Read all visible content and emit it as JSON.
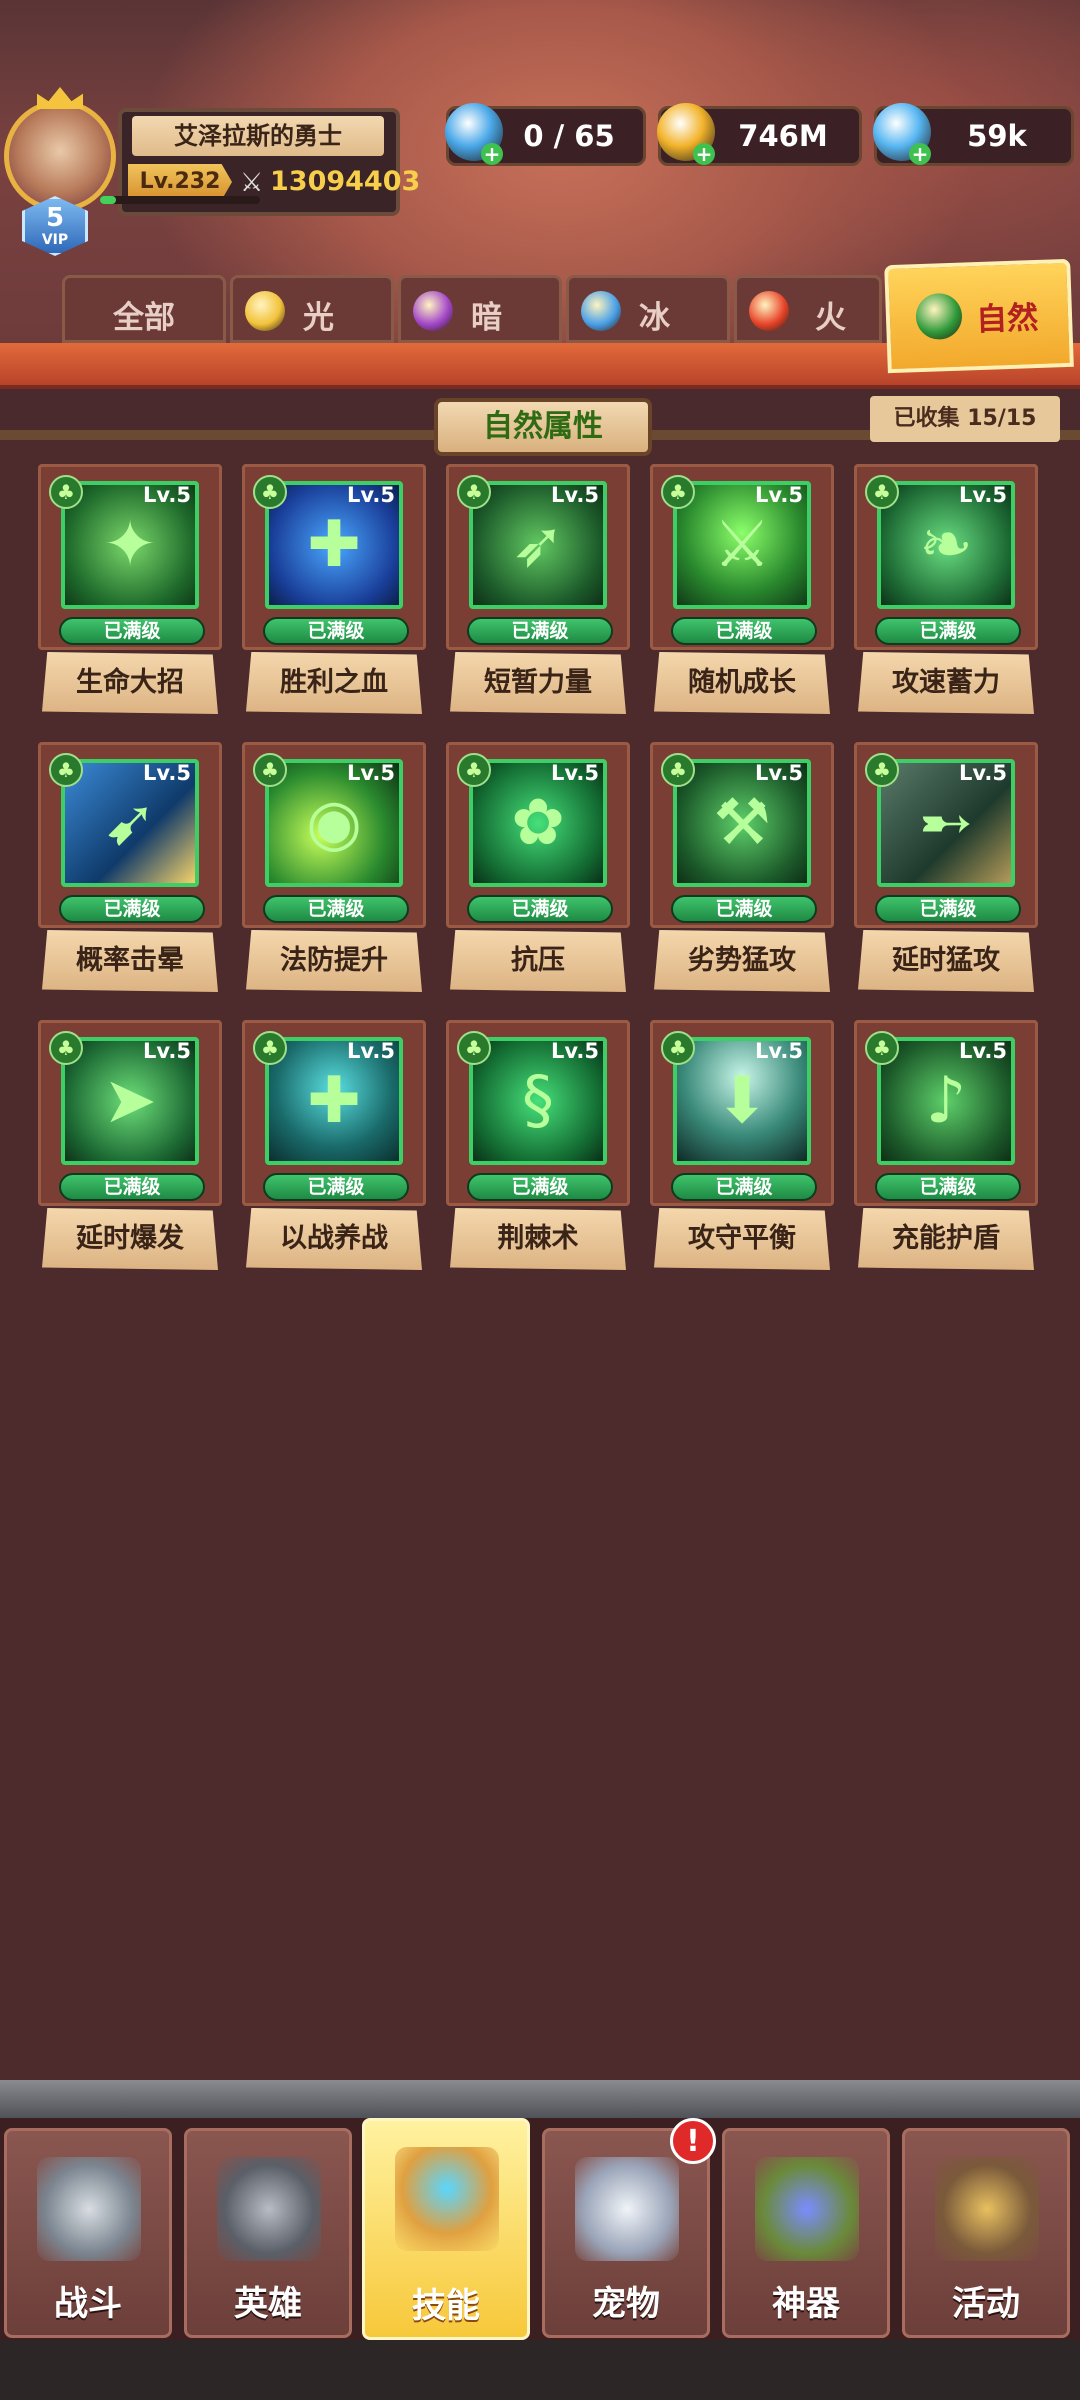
{
  "player": {
    "name": "艾泽拉斯的勇士",
    "level": "Lv.232",
    "power": "13094403",
    "vip_level": "5",
    "vip_label": "VIP",
    "xp_fraction": 0.1
  },
  "resources": [
    {
      "name": "star-icon",
      "value": "0 / 65",
      "color": "#4aa8e8"
    },
    {
      "name": "gold-coin-icon",
      "value": "746M",
      "color": "#f2b32a"
    },
    {
      "name": "diamond-icon",
      "value": "59k",
      "color": "#58b7f2"
    }
  ],
  "tabs": [
    {
      "label": "全部",
      "icon": "",
      "color": ""
    },
    {
      "label": "光",
      "icon": "sun-icon",
      "color": "#f2c23a"
    },
    {
      "label": "暗",
      "icon": "dark-eye-icon",
      "color": "#a347c9"
    },
    {
      "label": "冰",
      "icon": "ice-crystal-icon",
      "color": "#4aa0e8"
    },
    {
      "label": "火",
      "icon": "flame-icon",
      "color": "#e8442a"
    },
    {
      "label": "自然",
      "icon": "clover-icon",
      "color": "#2f9a3a"
    }
  ],
  "active_tab": "自然",
  "section": {
    "title": "自然属性",
    "collected": "已收集 15/15"
  },
  "skills": [
    {
      "name": "生命大招",
      "level": "Lv.5",
      "status": "已满级",
      "glyph": "✦"
    },
    {
      "name": "胜利之血",
      "level": "Lv.5",
      "status": "已满级",
      "glyph": "✚"
    },
    {
      "name": "短暂力量",
      "level": "Lv.5",
      "status": "已满级",
      "glyph": "➶"
    },
    {
      "name": "随机成长",
      "level": "Lv.5",
      "status": "已满级",
      "glyph": "⚔"
    },
    {
      "name": "攻速蓄力",
      "level": "Lv.5",
      "status": "已满级",
      "glyph": "❧"
    },
    {
      "name": "概率击晕",
      "level": "Lv.5",
      "status": "已满级",
      "glyph": "➹"
    },
    {
      "name": "法防提升",
      "level": "Lv.5",
      "status": "已满级",
      "glyph": "◉"
    },
    {
      "name": "抗压",
      "level": "Lv.5",
      "status": "已满级",
      "glyph": "✿"
    },
    {
      "name": "劣势猛攻",
      "level": "Lv.5",
      "status": "已满级",
      "glyph": "⚒"
    },
    {
      "name": "延时猛攻",
      "level": "Lv.5",
      "status": "已满级",
      "glyph": "➸"
    },
    {
      "name": "延时爆发",
      "level": "Lv.5",
      "status": "已满级",
      "glyph": "➤"
    },
    {
      "name": "以战养战",
      "level": "Lv.5",
      "status": "已满级",
      "glyph": "✚"
    },
    {
      "name": "荆棘术",
      "level": "Lv.5",
      "status": "已满级",
      "glyph": "§"
    },
    {
      "name": "攻守平衡",
      "level": "Lv.5",
      "status": "已满级",
      "glyph": "⬇"
    },
    {
      "name": "充能护盾",
      "level": "Lv.5",
      "status": "已满级",
      "glyph": "♪"
    }
  ],
  "bottom_nav": [
    {
      "label": "战斗",
      "icon": "crossed-swords-icon"
    },
    {
      "label": "英雄",
      "icon": "helmet-icon"
    },
    {
      "label": "技能",
      "icon": "spellbook-icon"
    },
    {
      "label": "宠物",
      "icon": "pet-wings-icon"
    },
    {
      "label": "神器",
      "icon": "artifact-icon"
    },
    {
      "label": "活动",
      "icon": "event-horn-icon"
    }
  ],
  "active_nav": "技能",
  "alert_text": "!"
}
